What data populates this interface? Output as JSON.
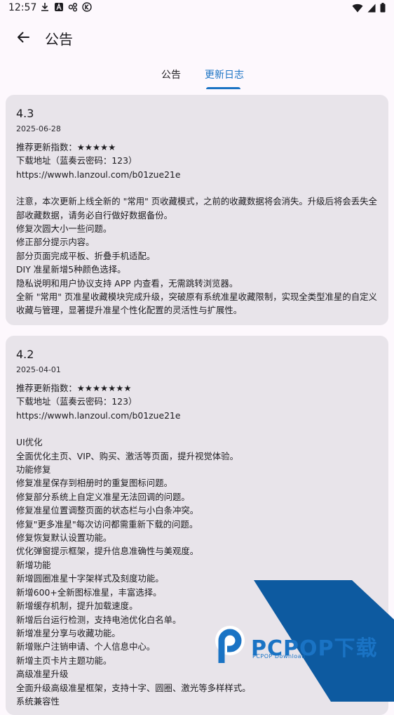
{
  "status_bar": {
    "time": "12:57",
    "left_icons": [
      "download-icon",
      "a-icon",
      "link-icon",
      "k-icon"
    ],
    "right_icons": [
      "wifi-icon",
      "signal-icon",
      "battery-icon"
    ]
  },
  "header": {
    "title": "公告",
    "back_icon": "arrow-left-icon"
  },
  "tabs": [
    {
      "label": "公告",
      "selected": false
    },
    {
      "label": "更新日志",
      "selected": true
    }
  ],
  "accent": "#1a73c4",
  "changelog": [
    {
      "version": "4.3",
      "date": "2025-06-28",
      "rating": "推荐更新指数：★★★★★",
      "download": "下载地址（蓝奏云密码：123）",
      "url": "https://wwwh.lanzoul.com/b01zue21e",
      "notes": [
        "注意，本次更新上线全新的 \"常用\" 页收藏模式，之前的收藏数据将会消失。升级后将会丢失全部收藏数据，请务必自行做好数据备份。",
        "修复次圆大小一些问题。",
        "修正部分提示内容。",
        "部分页面完成平板、折叠手机适配。",
        "DIY 准星新增5种颜色选择。",
        "隐私说明和用户协议支持 APP 内查看，无需跳转浏览器。",
        "全新 \"常用\" 页准星收藏模块完成升级，突破原有系统准星收藏限制，实现全类型准星的自定义收藏与管理，显著提升准星个性化配置的灵活性与扩展性。"
      ]
    },
    {
      "version": "4.2",
      "date": "2025-04-01",
      "rating": "推荐更新指数：★★★★★★★",
      "download": "下载地址（蓝奏云密码：123）",
      "url": "https://wwwh.lanzoul.com/b01zue21e",
      "notes": [
        "UI优化",
        "全面优化主页、VIP、购买、激活等页面，提升视觉体验。",
        "功能修复",
        "修复准星保存到相册时的重复图标问题。",
        "修复部分系统上自定义准星无法回调的问题。",
        "修复准星位置调整页面的状态栏与小白条冲突。",
        "修复\"更多准星\"每次访问都需重新下载的问题。",
        "修复恢复默认设置功能。",
        "优化弹窗提示框架，提升信息准确性与美观度。",
        "新增功能",
        "新增圆圈准星十字架样式及刻度功能。",
        "新增600+全新图标准星，丰富选择。",
        "新增缓存机制，提升加载速度。",
        "新增后台运行检测，支持电池优化白名单。",
        "新增准星分享与收藏功能。",
        "新增账户注销申请、个人信息中心。",
        "新增主页卡片主题功能。",
        "高级准星升级",
        "全面升级高级准星框架，支持十字、圆圈、激光等多样样式。",
        "系统兼容性"
      ]
    }
  ],
  "watermark": {
    "brand": "PCPOP下载",
    "sub": "PCPOP Download"
  }
}
